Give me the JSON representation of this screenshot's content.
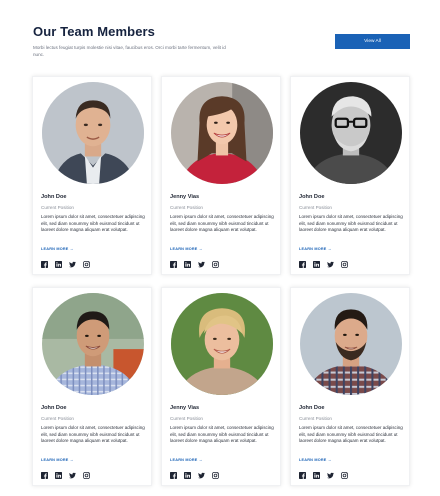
{
  "header": {
    "title": "Our Team Members",
    "subtitle": "Morbi lectus feugiat turpis molestie nisi vitae, faucibus eros. Orci morbi tarte fermentum, velit id nunc.",
    "view_all_label": "View All"
  },
  "learn_more_label": "LEARN MORE →",
  "social_icons": [
    "facebook-icon",
    "linkedin-icon",
    "twitter-icon",
    "instagram-icon"
  ],
  "members": [
    {
      "name": "John Doe",
      "position": "Current Position",
      "bio": "Lorem ipsum dolor sit amet, consectetuer adipiscing elit, sed diam nonummy nibh euismod tincidunt ut laoreet dolore magna aliquam erat volutpat.",
      "photo": "man-suit-portrait"
    },
    {
      "name": "Jenny Vias",
      "position": "Current Position",
      "bio": "Lorem ipsum dolor sit amet, consectetuer adipiscing elit, sed diam nonummy nibh euismod tincidunt ut laoreet dolore magna aliquam erat volutpat.",
      "photo": "woman-red-top-portrait"
    },
    {
      "name": "John Doe",
      "position": "Current Position",
      "bio": "Lorem ipsum dolor sit amet, consectetuer adipiscing elit, sed diam nonummy nibh euismod tincidunt ut laoreet dolore magna aliquam erat volutpat.",
      "photo": "man-glasses-bw-portrait"
    },
    {
      "name": "John Doe",
      "position": "Current Position",
      "bio": "Lorem ipsum dolor sit amet, consectetuer adipiscing elit, sed diam nonummy nibh euismod tincidunt ut laoreet dolore magna aliquam erat volutpat.",
      "photo": "man-plaid-shirt-portrait"
    },
    {
      "name": "Jenny Vias",
      "position": "Current Position",
      "bio": "Lorem ipsum dolor sit amet, consectetuer adipiscing elit, sed diam nonummy nibh euismod tincidunt ut laoreet dolore magna aliquam erat volutpat.",
      "photo": "woman-blonde-outdoor-portrait"
    },
    {
      "name": "John Doe",
      "position": "Current Position",
      "bio": "Lorem ipsum dolor sit amet, consectetuer adipiscing elit, sed diam nonummy nibh euismod tincidunt ut laoreet dolore magna aliquam erat volutpat.",
      "photo": "man-beard-plaid-portrait"
    }
  ],
  "colors": {
    "accent": "#1a62b6",
    "title": "#16233f",
    "muted": "#8a8f99"
  }
}
